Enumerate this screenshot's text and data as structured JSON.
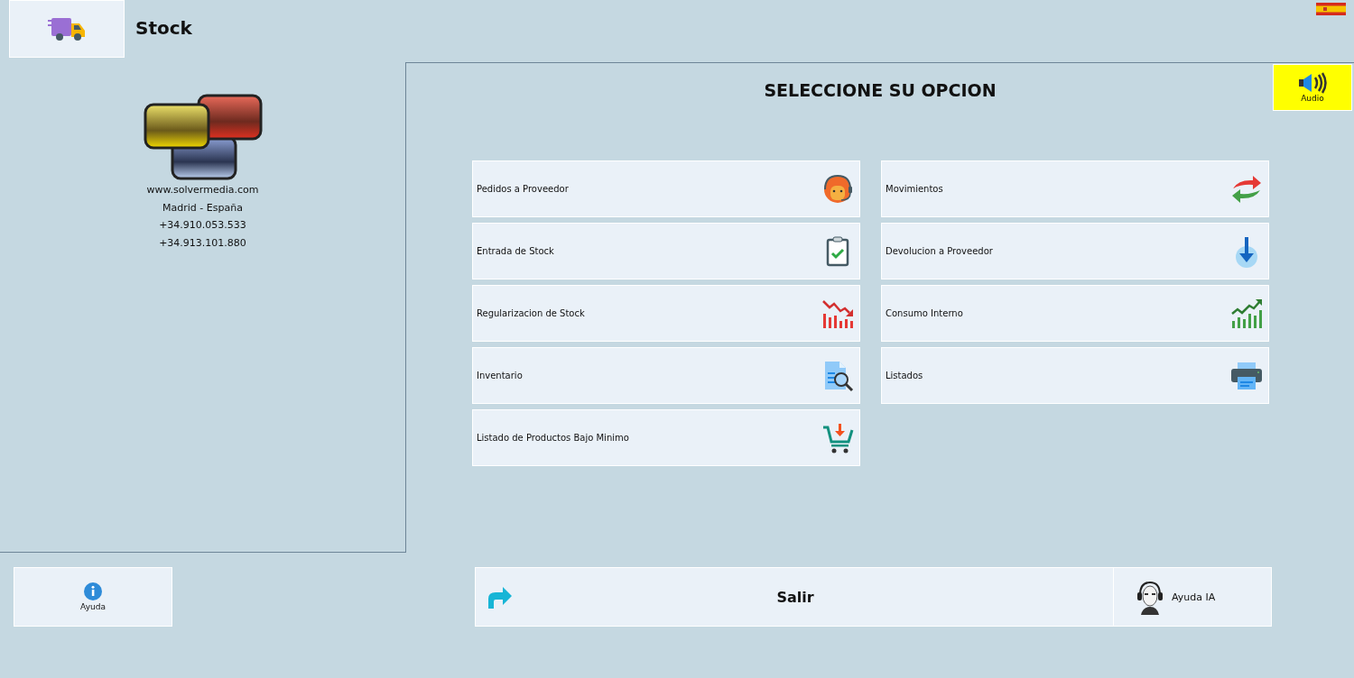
{
  "header": {
    "title": "Stock"
  },
  "company": {
    "lines": [
      "www.solvermedia.com",
      "Madrid - España",
      "+34.910.053.533",
      "+34.913.101.880"
    ]
  },
  "heading": "SELECCIONE SU OPCION",
  "audio": {
    "label": "Audio"
  },
  "menu_columns": [
    [
      {
        "label": "Pedidos a Proveedor",
        "kind": "agent"
      },
      {
        "label": "Entrada de Stock",
        "kind": "clipboard"
      },
      {
        "label": "Regularizacion de Stock",
        "kind": "chartdown"
      },
      {
        "label": "Inventario",
        "kind": "docsearch"
      },
      {
        "label": "Listado de Productos Bajo Minimo",
        "kind": "cart"
      }
    ],
    [
      {
        "label": "Movimientos",
        "kind": "swap"
      },
      {
        "label": "Devolucion a Proveedor",
        "kind": "downarrow"
      },
      {
        "label": "Consumo Interno",
        "kind": "chartup"
      },
      {
        "label": "Listados",
        "kind": "printer"
      }
    ]
  ],
  "help": {
    "label": "Ayuda"
  },
  "exit": {
    "label": "Salir"
  },
  "ai_help": {
    "label": "Ayuda IA"
  }
}
